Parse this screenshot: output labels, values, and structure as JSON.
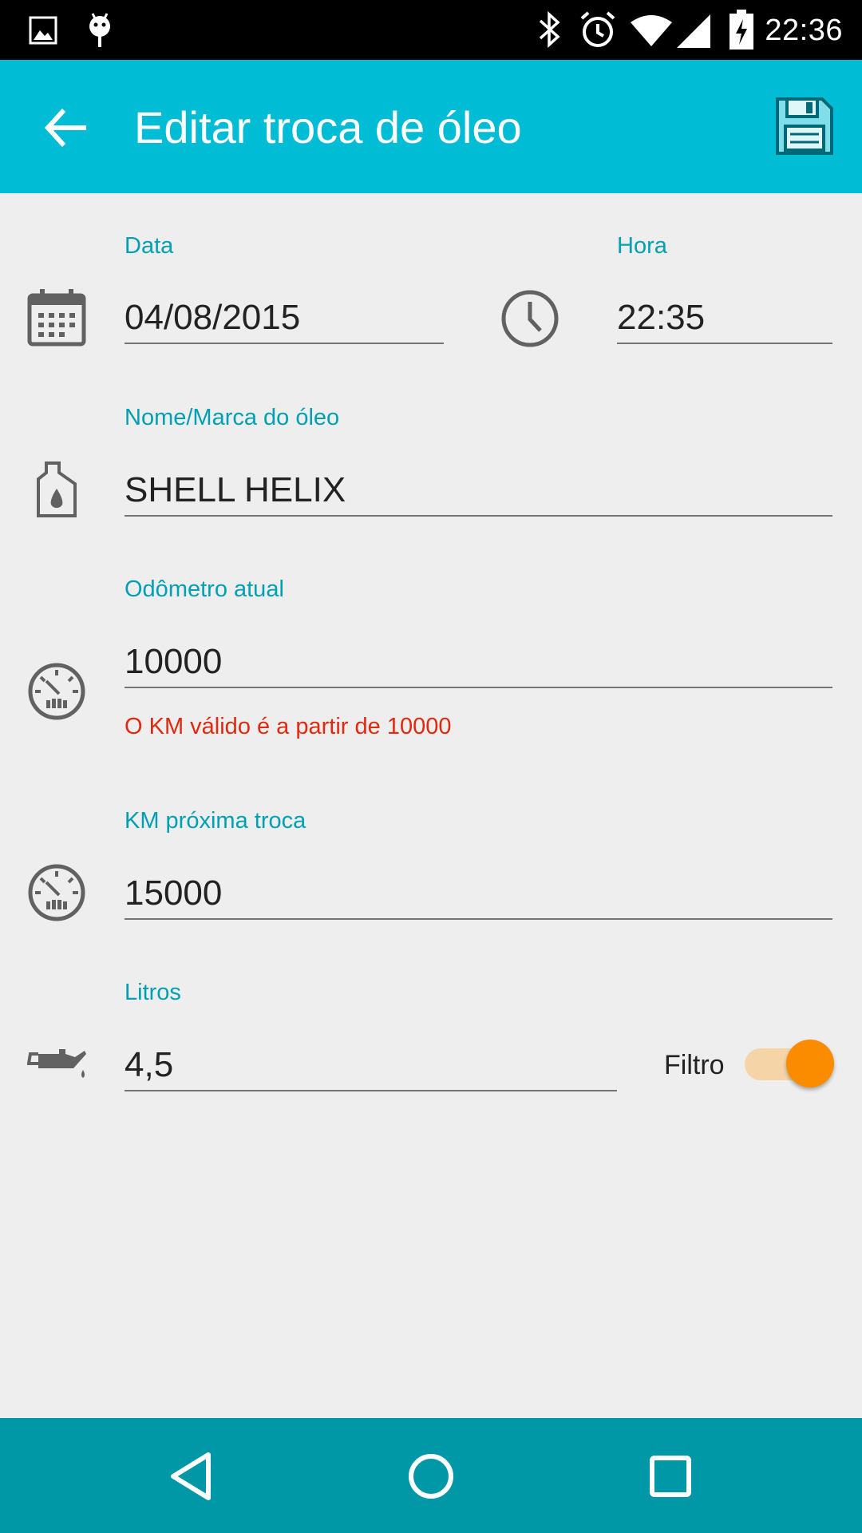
{
  "status_bar": {
    "time": "22:36",
    "icons": [
      "image-icon",
      "android-icon",
      "bluetooth-icon",
      "alarm-icon",
      "wifi-icon",
      "signal-icon",
      "battery-charging-icon"
    ]
  },
  "app_bar": {
    "title": "Editar troca de óleo",
    "back_icon": "arrow-back-icon",
    "save_icon": "floppy-disk-icon"
  },
  "form": {
    "date": {
      "label": "Data",
      "value": "04/08/2015",
      "icon": "calendar-icon"
    },
    "time": {
      "label": "Hora",
      "value": "22:35",
      "icon": "clock-icon"
    },
    "oil_name": {
      "label": "Nome/Marca do óleo",
      "value": "SHELL HELIX",
      "icon": "oil-bottle-icon"
    },
    "odometer": {
      "label": "Odômetro atual",
      "value": "10000",
      "error": "O KM válido é a partir de 10000",
      "icon": "speedometer-icon"
    },
    "next_km": {
      "label": "KM próxima troca",
      "value": "15000",
      "icon": "speedometer-icon"
    },
    "liters": {
      "label": "Litros",
      "value": "4,5",
      "icon": "oil-can-icon"
    },
    "filter": {
      "label": "Filtro",
      "checked": true
    }
  },
  "colors": {
    "app_bar": "#00bcd4",
    "nav_bar": "#0097a7",
    "label": "#00a0b4",
    "error": "#e02a10",
    "switch_thumb": "#fb8c00",
    "switch_track": "#f5d4a8"
  },
  "nav_bar": {
    "icons": [
      "back-triangle-icon",
      "home-circle-icon",
      "recents-square-icon"
    ]
  }
}
